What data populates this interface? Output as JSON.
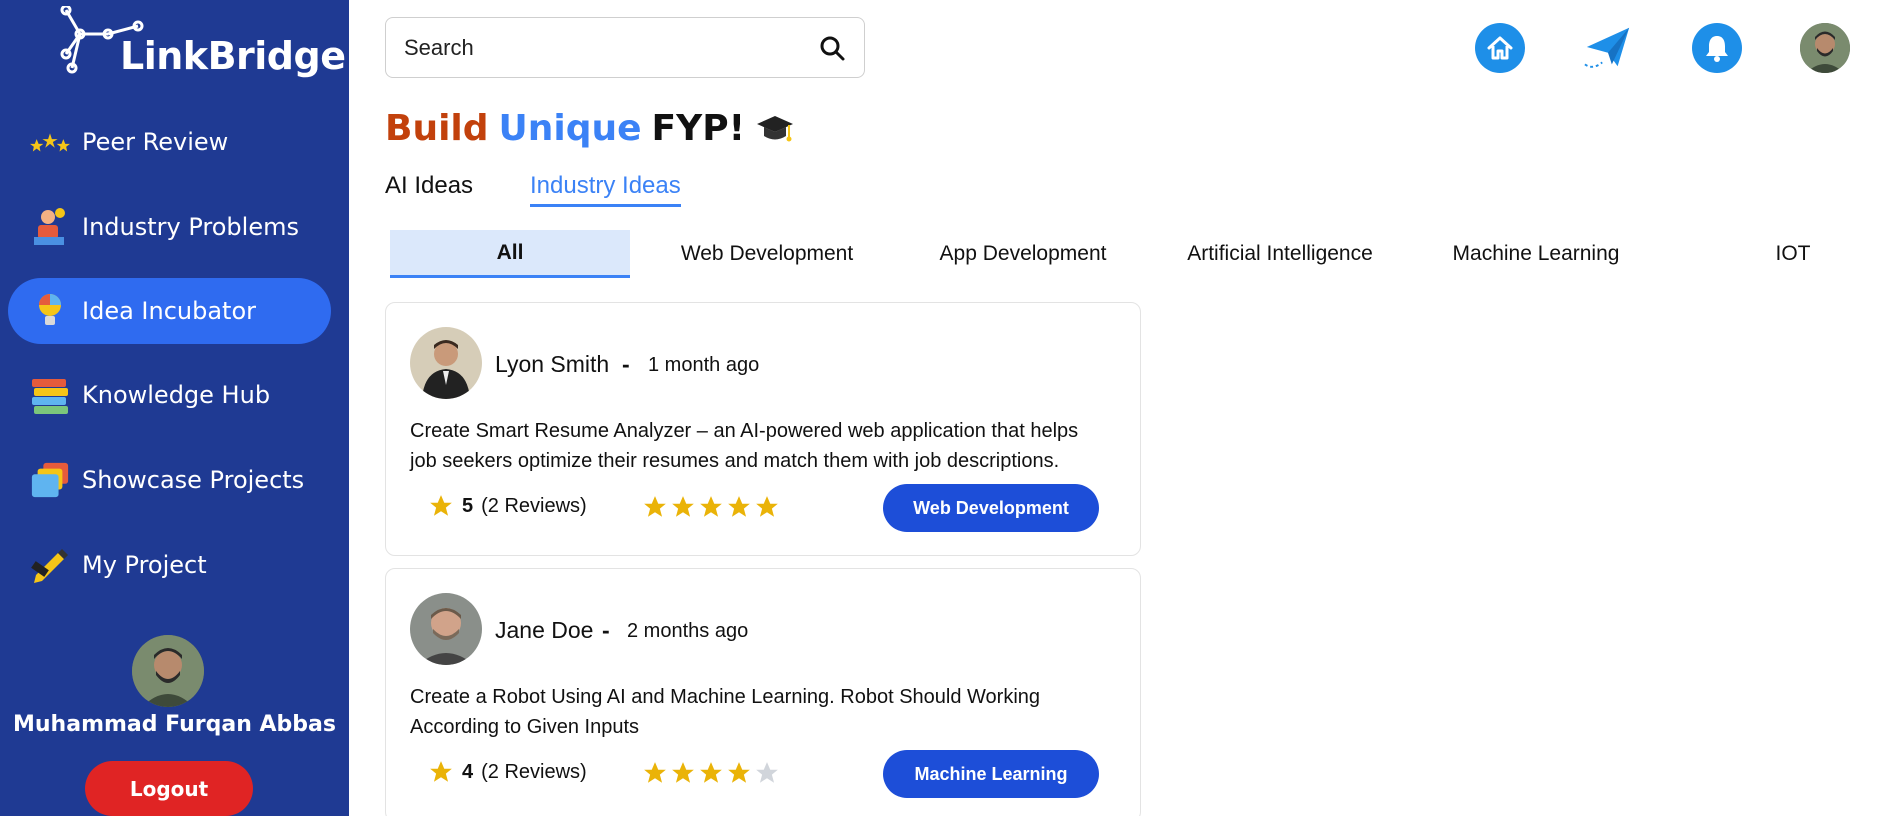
{
  "app": {
    "logo_text": "LinkBridge"
  },
  "sidebar": {
    "items": [
      {
        "label": "Peer Review",
        "icon": "stars-icon",
        "active": false
      },
      {
        "label": "Industry Problems",
        "icon": "worker-icon",
        "active": false
      },
      {
        "label": "Idea Incubator",
        "icon": "lightbulb-icon",
        "active": true
      },
      {
        "label": "Knowledge Hub",
        "icon": "books-icon",
        "active": false
      },
      {
        "label": "Showcase Projects",
        "icon": "folders-icon",
        "active": false
      },
      {
        "label": "My Project",
        "icon": "pencil-icon",
        "active": false
      }
    ],
    "user_name": "Muhammad Furqan Abbas",
    "logout_label": "Logout"
  },
  "header": {
    "search_placeholder": "Search",
    "icons": [
      "home-icon",
      "send-icon",
      "bell-icon",
      "user-avatar"
    ]
  },
  "page": {
    "title_parts": [
      "Build",
      "Unique",
      "FYP!"
    ],
    "title_icon": "graduation-cap-icon",
    "idea_tabs": [
      {
        "label": "AI Ideas",
        "active": false
      },
      {
        "label": "Industry Ideas",
        "active": true
      }
    ],
    "categories": [
      {
        "label": "All",
        "active": true
      },
      {
        "label": "Web Development",
        "active": false
      },
      {
        "label": "App Development",
        "active": false
      },
      {
        "label": "Artificial Intelligence",
        "active": false
      },
      {
        "label": "Machine Learning",
        "active": false
      },
      {
        "label": "IOT",
        "active": false
      }
    ]
  },
  "ideas": [
    {
      "author": "Lyon Smith",
      "time": "1 month ago",
      "description": "Create Smart Resume Analyzer – an AI-powered web application that helps job seekers optimize their resumes and match them with job descriptions.",
      "rating": "5",
      "reviews": "(2 Reviews)",
      "stars_filled": 5,
      "tag": "Web Development"
    },
    {
      "author": "Jane Doe",
      "time": "2 months ago",
      "description": "Create a Robot Using AI and Machine Learning. Robot Should Working According to Given Inputs",
      "rating": "4",
      "reviews": "(2 Reviews)",
      "stars_filled": 4,
      "tag": "Machine Learning"
    }
  ],
  "colors": {
    "sidebar_bg": "#1f3a93",
    "active_nav": "#2f6bf0",
    "logout": "#e02424",
    "accent_blue": "#3b82f6",
    "tag_bg": "#1d4ed8",
    "star": "#eab308",
    "star_empty": "#d1d5db"
  }
}
